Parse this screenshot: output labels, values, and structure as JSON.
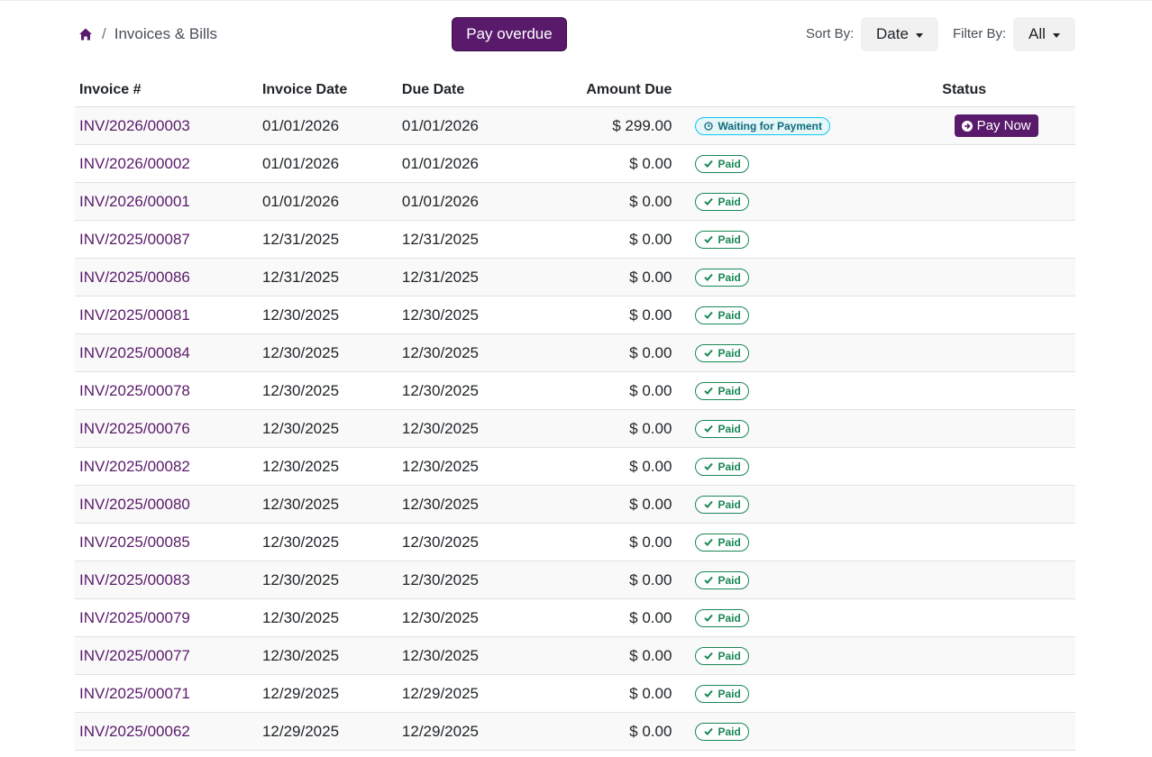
{
  "breadcrumb": {
    "home_icon": "home-icon",
    "separator": "/",
    "current": "Invoices & Bills"
  },
  "toolbar": {
    "pay_overdue_label": "Pay overdue",
    "sort_label": "Sort By:",
    "sort_value": "Date",
    "filter_label": "Filter By:",
    "filter_value": "All"
  },
  "colors": {
    "brand": "#5a1a6b",
    "paid": "#198754",
    "waiting": "#0dcaf0"
  },
  "table": {
    "headers": {
      "invoice": "Invoice #",
      "invoice_date": "Invoice Date",
      "due_date": "Due Date",
      "amount_due": "Amount Due",
      "status": "Status"
    },
    "rows": [
      {
        "invoice": "INV/2026/00003",
        "invoice_date": "01/01/2026",
        "due_date": "01/01/2026",
        "amount": "$ 299.00",
        "badge": "Waiting for Payment",
        "badge_type": "waiting",
        "action": "Pay Now"
      },
      {
        "invoice": "INV/2026/00002",
        "invoice_date": "01/01/2026",
        "due_date": "01/01/2026",
        "amount": "$ 0.00",
        "badge": "Paid",
        "badge_type": "paid"
      },
      {
        "invoice": "INV/2026/00001",
        "invoice_date": "01/01/2026",
        "due_date": "01/01/2026",
        "amount": "$ 0.00",
        "badge": "Paid",
        "badge_type": "paid"
      },
      {
        "invoice": "INV/2025/00087",
        "invoice_date": "12/31/2025",
        "due_date": "12/31/2025",
        "amount": "$ 0.00",
        "badge": "Paid",
        "badge_type": "paid"
      },
      {
        "invoice": "INV/2025/00086",
        "invoice_date": "12/31/2025",
        "due_date": "12/31/2025",
        "amount": "$ 0.00",
        "badge": "Paid",
        "badge_type": "paid"
      },
      {
        "invoice": "INV/2025/00081",
        "invoice_date": "12/30/2025",
        "due_date": "12/30/2025",
        "amount": "$ 0.00",
        "badge": "Paid",
        "badge_type": "paid"
      },
      {
        "invoice": "INV/2025/00084",
        "invoice_date": "12/30/2025",
        "due_date": "12/30/2025",
        "amount": "$ 0.00",
        "badge": "Paid",
        "badge_type": "paid"
      },
      {
        "invoice": "INV/2025/00078",
        "invoice_date": "12/30/2025",
        "due_date": "12/30/2025",
        "amount": "$ 0.00",
        "badge": "Paid",
        "badge_type": "paid"
      },
      {
        "invoice": "INV/2025/00076",
        "invoice_date": "12/30/2025",
        "due_date": "12/30/2025",
        "amount": "$ 0.00",
        "badge": "Paid",
        "badge_type": "paid"
      },
      {
        "invoice": "INV/2025/00082",
        "invoice_date": "12/30/2025",
        "due_date": "12/30/2025",
        "amount": "$ 0.00",
        "badge": "Paid",
        "badge_type": "paid"
      },
      {
        "invoice": "INV/2025/00080",
        "invoice_date": "12/30/2025",
        "due_date": "12/30/2025",
        "amount": "$ 0.00",
        "badge": "Paid",
        "badge_type": "paid"
      },
      {
        "invoice": "INV/2025/00085",
        "invoice_date": "12/30/2025",
        "due_date": "12/30/2025",
        "amount": "$ 0.00",
        "badge": "Paid",
        "badge_type": "paid"
      },
      {
        "invoice": "INV/2025/00083",
        "invoice_date": "12/30/2025",
        "due_date": "12/30/2025",
        "amount": "$ 0.00",
        "badge": "Paid",
        "badge_type": "paid"
      },
      {
        "invoice": "INV/2025/00079",
        "invoice_date": "12/30/2025",
        "due_date": "12/30/2025",
        "amount": "$ 0.00",
        "badge": "Paid",
        "badge_type": "paid"
      },
      {
        "invoice": "INV/2025/00077",
        "invoice_date": "12/30/2025",
        "due_date": "12/30/2025",
        "amount": "$ 0.00",
        "badge": "Paid",
        "badge_type": "paid"
      },
      {
        "invoice": "INV/2025/00071",
        "invoice_date": "12/29/2025",
        "due_date": "12/29/2025",
        "amount": "$ 0.00",
        "badge": "Paid",
        "badge_type": "paid"
      },
      {
        "invoice": "INV/2025/00062",
        "invoice_date": "12/29/2025",
        "due_date": "12/29/2025",
        "amount": "$ 0.00",
        "badge": "Paid",
        "badge_type": "paid"
      }
    ]
  }
}
